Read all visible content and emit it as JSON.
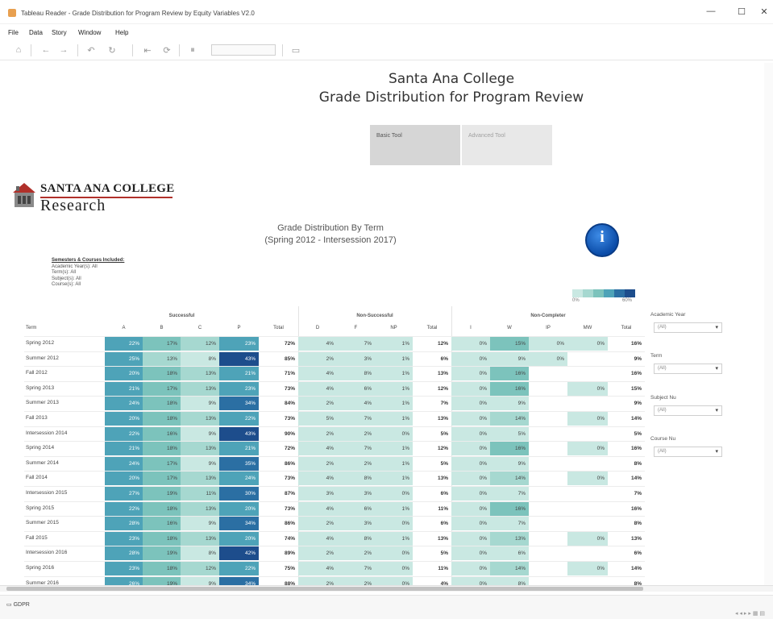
{
  "window": {
    "title": "Tableau Reader - Grade Distribution for Program Review by Equity Variables V2.0",
    "minimize": "—",
    "maximize": "☐",
    "close": "✕"
  },
  "menu": [
    "File",
    "Data",
    "Story",
    "Window",
    "Help"
  ],
  "dashboard": {
    "title_line1": "Santa Ana College",
    "title_line2": "Grade Distribution for Program Review",
    "tab_basic": "Basic Tool",
    "tab_advanced": "Advanced Tool",
    "logo_line1": "SANTA ANA COLLEGE",
    "logo_line2": "Research",
    "chart_title_line1": "Grade Distribution By Term",
    "chart_title_line2": "(Spring 2012 - Intersession 2017)",
    "included_header": "Semesters & Courses Included:",
    "included_lines": [
      "Academic Year(s): All",
      "Term(s): All",
      "Subject(s): All",
      "Course(s): All"
    ],
    "legend_min": "0%",
    "legend_max": "60%",
    "legend_colors": [
      "#c9e8e2",
      "#a6d8d0",
      "#7cc3bc",
      "#4ea3b8",
      "#2b6fa3",
      "#1d4d8c"
    ]
  },
  "table": {
    "group_headers": [
      "Successful",
      "Non-Successful",
      "Non-Completer"
    ],
    "col_headers": [
      "Term",
      "A",
      "B",
      "C",
      "P",
      "Total",
      "D",
      "F",
      "NP",
      "Total",
      "I",
      "W",
      "IP",
      "MW",
      "Total"
    ],
    "rows": [
      {
        "term": "Spring 2012",
        "vals": [
          "22%",
          "17%",
          "12%",
          "23%",
          "72%",
          "4%",
          "7%",
          "1%",
          "12%",
          "0%",
          "15%",
          "0%",
          "0%",
          "16%"
        ]
      },
      {
        "term": "Summer 2012",
        "vals": [
          "25%",
          "13%",
          "8%",
          "43%",
          "85%",
          "2%",
          "3%",
          "1%",
          "6%",
          "0%",
          "9%",
          "0%",
          "",
          "9%"
        ]
      },
      {
        "term": "Fall 2012",
        "vals": [
          "20%",
          "18%",
          "13%",
          "21%",
          "71%",
          "4%",
          "8%",
          "1%",
          "13%",
          "0%",
          "16%",
          "",
          "",
          "16%"
        ]
      },
      {
        "term": "Spring 2013",
        "vals": [
          "21%",
          "17%",
          "13%",
          "23%",
          "73%",
          "4%",
          "6%",
          "1%",
          "12%",
          "0%",
          "16%",
          "",
          "0%",
          "15%"
        ]
      },
      {
        "term": "Summer 2013",
        "vals": [
          "24%",
          "18%",
          "9%",
          "34%",
          "84%",
          "2%",
          "4%",
          "1%",
          "7%",
          "0%",
          "9%",
          "",
          "",
          "9%"
        ]
      },
      {
        "term": "Fall 2013",
        "vals": [
          "20%",
          "18%",
          "13%",
          "22%",
          "73%",
          "5%",
          "7%",
          "1%",
          "13%",
          "0%",
          "14%",
          "",
          "0%",
          "14%"
        ]
      },
      {
        "term": "Intersession 2014",
        "vals": [
          "22%",
          "16%",
          "9%",
          "43%",
          "90%",
          "2%",
          "2%",
          "0%",
          "5%",
          "0%",
          "5%",
          "",
          "",
          "5%"
        ]
      },
      {
        "term": "Spring 2014",
        "vals": [
          "21%",
          "18%",
          "13%",
          "21%",
          "72%",
          "4%",
          "7%",
          "1%",
          "12%",
          "0%",
          "16%",
          "",
          "0%",
          "16%"
        ]
      },
      {
        "term": "Summer 2014",
        "vals": [
          "24%",
          "17%",
          "9%",
          "35%",
          "86%",
          "2%",
          "2%",
          "1%",
          "5%",
          "0%",
          "9%",
          "",
          "",
          "8%"
        ]
      },
      {
        "term": "Fall 2014",
        "vals": [
          "20%",
          "17%",
          "13%",
          "24%",
          "73%",
          "4%",
          "8%",
          "1%",
          "13%",
          "0%",
          "14%",
          "",
          "0%",
          "14%"
        ]
      },
      {
        "term": "Intersession 2015",
        "vals": [
          "27%",
          "19%",
          "11%",
          "30%",
          "87%",
          "3%",
          "3%",
          "0%",
          "6%",
          "0%",
          "7%",
          "",
          "",
          "7%"
        ]
      },
      {
        "term": "Spring 2015",
        "vals": [
          "22%",
          "18%",
          "13%",
          "20%",
          "73%",
          "4%",
          "6%",
          "1%",
          "11%",
          "0%",
          "16%",
          "",
          "",
          "16%"
        ]
      },
      {
        "term": "Summer 2015",
        "vals": [
          "28%",
          "16%",
          "9%",
          "34%",
          "86%",
          "2%",
          "3%",
          "0%",
          "6%",
          "0%",
          "7%",
          "",
          "",
          "8%"
        ]
      },
      {
        "term": "Fall 2015",
        "vals": [
          "23%",
          "18%",
          "13%",
          "20%",
          "74%",
          "4%",
          "8%",
          "1%",
          "13%",
          "0%",
          "13%",
          "",
          "0%",
          "13%"
        ]
      },
      {
        "term": "Intersession 2016",
        "vals": [
          "28%",
          "19%",
          "8%",
          "42%",
          "89%",
          "2%",
          "2%",
          "0%",
          "5%",
          "0%",
          "6%",
          "",
          "",
          "6%"
        ]
      },
      {
        "term": "Spring 2016",
        "vals": [
          "23%",
          "18%",
          "12%",
          "22%",
          "75%",
          "4%",
          "7%",
          "0%",
          "11%",
          "0%",
          "14%",
          "",
          "0%",
          "14%"
        ]
      },
      {
        "term": "Summer 2016",
        "vals": [
          "26%",
          "19%",
          "9%",
          "34%",
          "88%",
          "2%",
          "2%",
          "0%",
          "4%",
          "0%",
          "8%",
          "",
          "",
          "8%"
        ]
      }
    ]
  },
  "filters": [
    {
      "label": "Academic Year",
      "value": "(All)"
    },
    {
      "label": "Term",
      "value": "(All)"
    },
    {
      "label": "Subject Nu",
      "value": "(All)"
    },
    {
      "label": "Course Nu",
      "value": "(All)"
    }
  ],
  "status": {
    "tab_label": "GDPR"
  },
  "colors": {
    "heat_low": "#c9e8e2",
    "heat_mid": "#4ea3b8",
    "heat_high": "#1d4d8c",
    "info_blue": "#0b4ca8",
    "logo_red": "#b0302a"
  }
}
